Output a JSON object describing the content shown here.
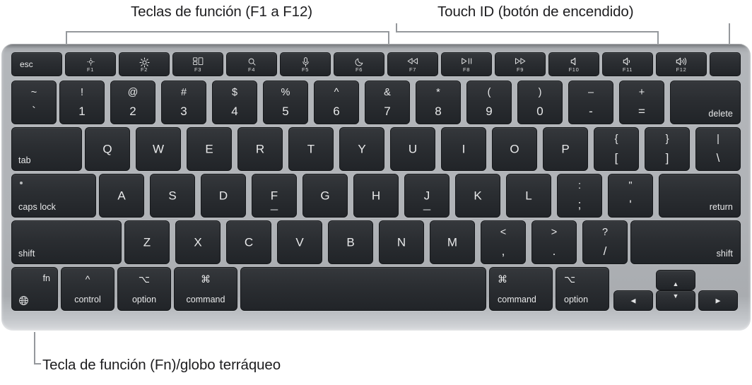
{
  "callouts": {
    "function_keys": "Teclas de función (F1 a F12)",
    "touch_id": "Touch ID (botón de encendido)",
    "fn_globe": "Tecla de función (Fn)/globo terráqueo"
  },
  "colors": {
    "page_background": "#ffffff",
    "chassis": "#b0b3b7",
    "key_face": "#2b2e32",
    "key_legend": "#e8e9ea",
    "leader_line": "#95989c",
    "label_text": "#1d1d1f"
  },
  "keyboard": {
    "layout": "US English — MacBook Air with Touch ID",
    "function_row": [
      {
        "name": "escape",
        "label": "esc",
        "icon": null,
        "fkey": null
      },
      {
        "name": "brightness-down",
        "label": null,
        "icon": "brightness-low-icon",
        "fkey": "F1"
      },
      {
        "name": "brightness-up",
        "label": null,
        "icon": "brightness-high-icon",
        "fkey": "F2"
      },
      {
        "name": "mission-control",
        "label": null,
        "icon": "mission-control-icon",
        "fkey": "F3"
      },
      {
        "name": "spotlight",
        "label": null,
        "icon": "search-icon",
        "fkey": "F4"
      },
      {
        "name": "dictation",
        "label": null,
        "icon": "microphone-icon",
        "fkey": "F5"
      },
      {
        "name": "do-not-disturb",
        "label": null,
        "icon": "moon-icon",
        "fkey": "F6"
      },
      {
        "name": "previous-track",
        "label": null,
        "icon": "rewind-icon",
        "fkey": "F7"
      },
      {
        "name": "play-pause",
        "label": null,
        "icon": "play-pause-icon",
        "fkey": "F8"
      },
      {
        "name": "next-track",
        "label": null,
        "icon": "fast-forward-icon",
        "fkey": "F9"
      },
      {
        "name": "mute",
        "label": null,
        "icon": "volume-mute-icon",
        "fkey": "F10"
      },
      {
        "name": "volume-down",
        "label": null,
        "icon": "volume-down-icon",
        "fkey": "F11"
      },
      {
        "name": "volume-up",
        "label": null,
        "icon": "volume-up-icon",
        "fkey": "F12"
      },
      {
        "name": "touch-id",
        "label": null,
        "icon": null,
        "fkey": null
      }
    ],
    "number_row": [
      {
        "name": "grave",
        "upper": "~",
        "lower": "`"
      },
      {
        "name": "one",
        "upper": "!",
        "lower": "1"
      },
      {
        "name": "two",
        "upper": "@",
        "lower": "2"
      },
      {
        "name": "three",
        "upper": "#",
        "lower": "3"
      },
      {
        "name": "four",
        "upper": "$",
        "lower": "4"
      },
      {
        "name": "five",
        "upper": "%",
        "lower": "5"
      },
      {
        "name": "six",
        "upper": "^",
        "lower": "6"
      },
      {
        "name": "seven",
        "upper": "&",
        "lower": "7"
      },
      {
        "name": "eight",
        "upper": "*",
        "lower": "8"
      },
      {
        "name": "nine",
        "upper": "(",
        "lower": "9"
      },
      {
        "name": "zero",
        "upper": ")",
        "lower": "0"
      },
      {
        "name": "minus",
        "upper": "–",
        "lower": "-"
      },
      {
        "name": "equal",
        "upper": "+",
        "lower": "="
      },
      {
        "name": "delete",
        "label": "delete"
      }
    ],
    "q_row": {
      "tab": "tab",
      "letters": [
        "Q",
        "W",
        "E",
        "R",
        "T",
        "Y",
        "U",
        "I",
        "O",
        "P"
      ],
      "bracket_left": {
        "upper": "{",
        "lower": "["
      },
      "bracket_right": {
        "upper": "}",
        "lower": "]"
      },
      "backslash": {
        "upper": "|",
        "lower": "\\"
      }
    },
    "a_row": {
      "caps_lock": "caps lock",
      "letters": [
        "A",
        "S",
        "D",
        "F",
        "G",
        "H",
        "J",
        "K",
        "L"
      ],
      "semicolon": {
        "upper": ":",
        "lower": ";"
      },
      "quote": {
        "upper": "\"",
        "lower": "'"
      },
      "return": "return"
    },
    "z_row": {
      "shift_left": "shift",
      "letters": [
        "Z",
        "X",
        "C",
        "V",
        "B",
        "N",
        "M"
      ],
      "comma": {
        "upper": "<",
        "lower": ","
      },
      "period": {
        "upper": ">",
        "lower": "."
      },
      "slash": {
        "upper": "?",
        "lower": "/"
      },
      "shift_right": "shift"
    },
    "bottom_row": {
      "fn": {
        "label": "fn",
        "icon": "globe-icon"
      },
      "control": {
        "symbol": "^",
        "label": "control"
      },
      "option_left": {
        "symbol": "⌥",
        "label": "option"
      },
      "command_left": {
        "symbol": "⌘",
        "label": "command"
      },
      "space": "",
      "command_right": {
        "symbol": "⌘",
        "label": "command"
      },
      "option_right": {
        "symbol": "⌥",
        "label": "option"
      },
      "arrows": {
        "left": "◀",
        "up": "▲",
        "down": "▼",
        "right": "▶"
      }
    }
  }
}
